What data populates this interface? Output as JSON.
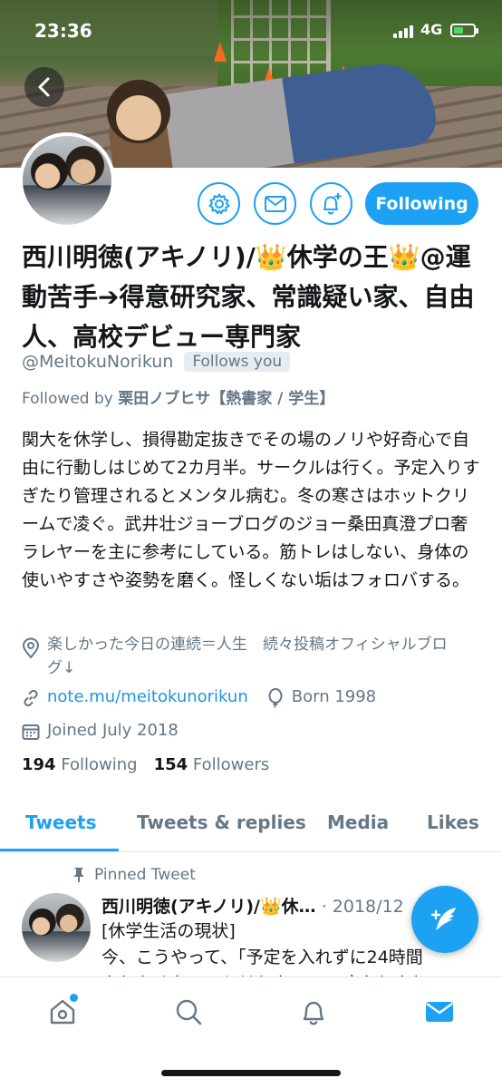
{
  "status_bar": {
    "time": "23:36",
    "network": "4G"
  },
  "profile": {
    "display_name": "西川明徳(アキノリ)/👑休学の王👑@運動苦手➔得意研究家、常識疑い家、自由人、高校デビュー専門家",
    "handle": "@MeitokuNorikun",
    "follows_you": "Follows you",
    "followed_by_prefix": "Followed by",
    "followed_by_name": "栗田ノブヒサ【熱書家 / 学生】",
    "following_button": "Following",
    "bio": "関大を休学し、損得勘定抜きでその場のノリや好奇心で自由に行動しはじめて2カ月半。サークルは行く。予定入りすぎたり管理されるとメンタル病む。冬の寒さはホットクリームで凌ぐ。武井壮ジョーブログのジョー桑田真澄プロ奢ラレヤーを主に参考にしている。筋トレはしない、身体の使いやすさや姿勢を磨く。怪しくない垢はフォロバする。",
    "location": "楽しかった今日の連続＝人生　続々投稿オフィシャルブログ↓",
    "link": "note.mu/meitokunorikun",
    "birth": "Born 1998",
    "joined": "Joined July 2018",
    "following_count": "194",
    "following_label": "Following",
    "followers_count": "154",
    "followers_label": "Followers"
  },
  "tabs": [
    {
      "label": "Tweets",
      "active": true
    },
    {
      "label": "Tweets & replies",
      "active": false
    },
    {
      "label": "Media",
      "active": false
    },
    {
      "label": "Likes",
      "active": false
    }
  ],
  "pinned_tweet": {
    "label": "Pinned Tweet",
    "author": "西川明徳(アキノリ)/👑休…",
    "date": "· 2018/12",
    "text": "[休学生活の現状]\n今、こうやって、「予定を入れずに24時間\nやりたくないことはしない」の底なしやり"
  },
  "colors": {
    "accent": "#1da1f2",
    "muted": "#657786",
    "text": "#14171a"
  },
  "icons": [
    "back-arrow-icon",
    "gear-icon",
    "mail-icon",
    "bell-plus-icon",
    "location-pin-icon",
    "link-icon",
    "balloon-icon",
    "calendar-icon",
    "pin-icon",
    "compose-icon",
    "home-icon",
    "search-icon",
    "bell-icon",
    "envelope-icon"
  ]
}
